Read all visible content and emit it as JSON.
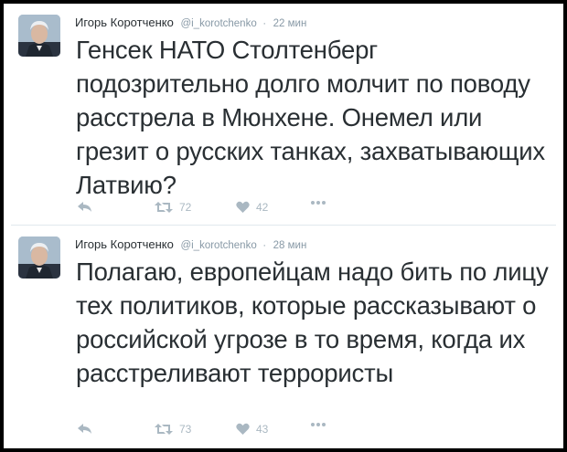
{
  "tweets": [
    {
      "author_name": "Игорь Коротченко",
      "handle": "@i_korotchenko",
      "separator": "·",
      "time": "22 мин",
      "text": "Генсек НАТО Столтенберг подозрительно долго молчит по поводу расстрела в Мюнхене. Онемел или грезит о русских танках, захватывающих Латвию?",
      "retweets": "72",
      "likes": "42"
    },
    {
      "author_name": "Игорь Коротченко",
      "handle": "@i_korotchenko",
      "separator": "·",
      "time": "28 мин",
      "text": "Полагаю, европейцам надо бить по лицу тех политиков, которые рассказывают о российской угрозе в то время, когда их расстреливают террористы",
      "retweets": "73",
      "likes": "43"
    }
  ],
  "icons": {
    "reply": "reply-icon",
    "retweet": "retweet-icon",
    "like": "heart-icon",
    "more": "more-icon"
  },
  "colors": {
    "text": "#292f33",
    "muted": "#8899a6",
    "action": "#aab8c2",
    "frame": "#000000"
  }
}
